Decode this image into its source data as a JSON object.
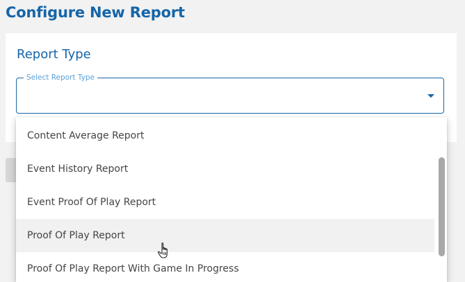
{
  "page": {
    "title": "Configure New Report"
  },
  "report_type": {
    "section_title": "Report Type",
    "select_label": "Select Report Type",
    "selected_value": ""
  },
  "dropdown": {
    "options": [
      {
        "label": "Content Average Report",
        "hovered": false
      },
      {
        "label": "Event History Report",
        "hovered": false
      },
      {
        "label": "Event Proof Of Play Report",
        "hovered": false
      },
      {
        "label": "Proof Of Play Report",
        "hovered": true
      },
      {
        "label": "Proof Of Play Report With Game In Progress",
        "hovered": false
      }
    ]
  },
  "icons": {
    "dropdown_arrow": "caret-down-icon",
    "cursor": "hand-pointer-icon"
  },
  "colors": {
    "accent": "#1565a8",
    "label_accent": "#5a9fd6",
    "text": "#444444",
    "hover_bg": "#f1f1f1",
    "page_bg": "#f2f2f2"
  }
}
